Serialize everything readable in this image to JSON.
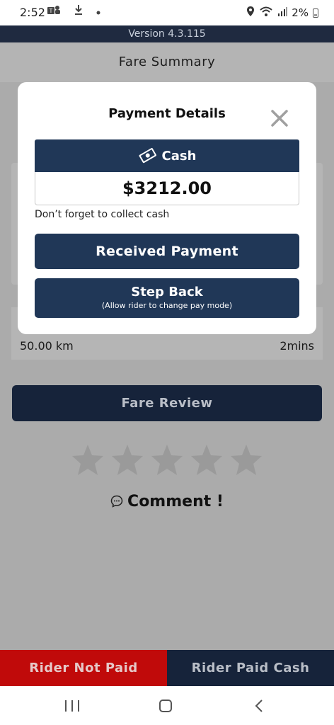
{
  "status_bar": {
    "time": "2:52",
    "battery_text": "2%"
  },
  "version": {
    "text": "Version 4.3.115"
  },
  "page": {
    "title": "Fare Summary",
    "trip": {
      "distance": "50.00 km",
      "duration": "2mins"
    },
    "fare_review_label": "Fare Review",
    "rating": {
      "max_stars": 5,
      "selected": 0
    },
    "comment_label": "Comment !"
  },
  "bottom_actions": {
    "not_paid_label": "Rider Not Paid",
    "paid_cash_label": "Rider Paid Cash"
  },
  "modal": {
    "title": "Payment Details",
    "pay_mode": "Cash",
    "amount": "$3212.00",
    "note": "Don’t forget to collect cash",
    "received_label": "Received Payment",
    "step_back_label": "Step Back",
    "step_back_sub": "(Allow rider to change pay mode)"
  },
  "colors": {
    "navy": "#203757",
    "dark_navy": "#16233a",
    "danger_red": "#c00a0a",
    "overlay_grey": "#ababab"
  }
}
